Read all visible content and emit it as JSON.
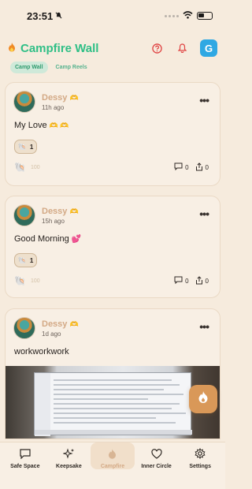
{
  "status_bar": {
    "time": "23:51",
    "bell_icon": "bell-slash-icon"
  },
  "header": {
    "title": "Campfire Wall",
    "logo_icon": "flame-icon",
    "help_icon": "question-circle-icon",
    "notification_icon": "bell-icon",
    "profile_initial": "G"
  },
  "tabs": [
    {
      "label": "Camp Wall",
      "active": true
    },
    {
      "label": "Camp Reels",
      "active": false
    }
  ],
  "posts": [
    {
      "author": "Dessy",
      "author_emoji": "🫶",
      "time_ago": "11h ago",
      "text": "My Love",
      "text_emoji": "🫶 🫶",
      "reaction_count": "1",
      "shell_count": "100",
      "comment_count": "0",
      "share_count": "0"
    },
    {
      "author": "Dessy",
      "author_emoji": "🫶",
      "time_ago": "15h ago",
      "text": "Good Morning",
      "text_emoji": "💕",
      "reaction_count": "1",
      "shell_count": "100",
      "comment_count": "0",
      "share_count": "0"
    },
    {
      "author": "Dessy",
      "author_emoji": "🫶",
      "time_ago": "1d ago",
      "text": "workworkwork",
      "text_emoji": ""
    }
  ],
  "bottom_nav": [
    {
      "label": "Safe Space",
      "icon": "chat-icon",
      "active": false
    },
    {
      "label": "Keepsake",
      "icon": "sparkles-icon",
      "active": false
    },
    {
      "label": "Campfire",
      "icon": "flame-icon",
      "active": true
    },
    {
      "label": "Inner Circle",
      "icon": "heart-icon",
      "active": false
    },
    {
      "label": "Settings",
      "icon": "gear-icon",
      "active": false
    }
  ],
  "colors": {
    "accent_green": "#2fbf86",
    "background": "#f6ebdd",
    "author_tan": "#d3a985",
    "fab": "#d99858"
  }
}
